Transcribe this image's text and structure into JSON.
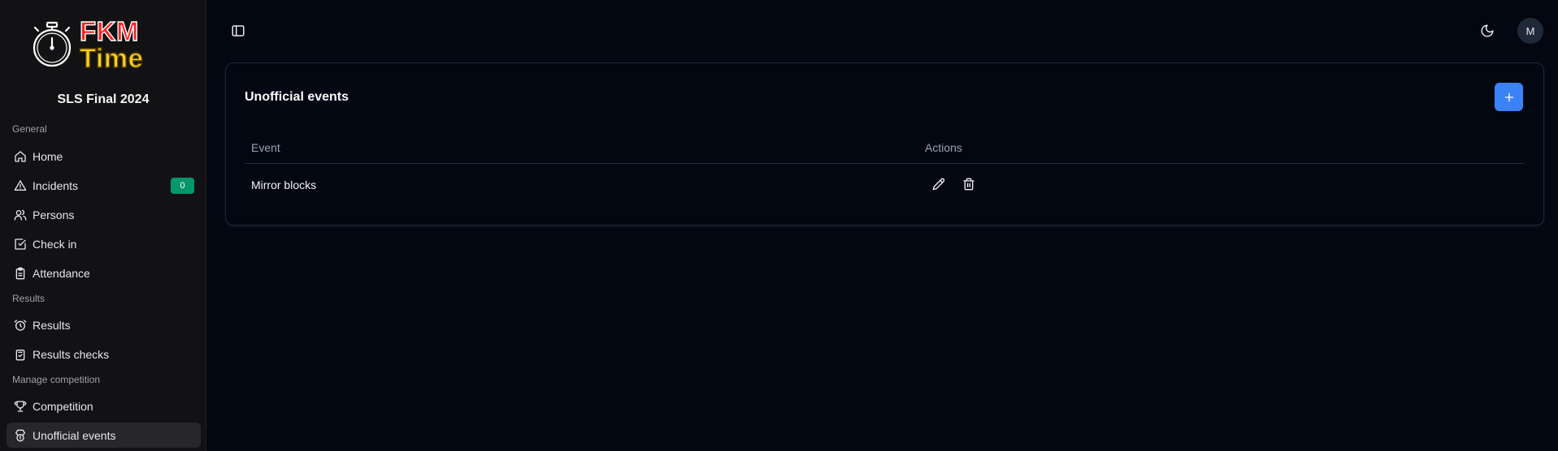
{
  "competition": {
    "name": "SLS Final 2024"
  },
  "logo": {
    "line1": "FKM",
    "line2": "Time"
  },
  "sidebar": {
    "groups": [
      {
        "label": "General"
      },
      {
        "label": "Results"
      },
      {
        "label": "Manage competition"
      }
    ],
    "items": [
      {
        "label": "Home",
        "icon": "home-icon"
      },
      {
        "label": "Incidents",
        "icon": "warning-icon",
        "badge": "0"
      },
      {
        "label": "Persons",
        "icon": "users-icon"
      },
      {
        "label": "Check in",
        "icon": "check-square-icon"
      },
      {
        "label": "Attendance",
        "icon": "clipboard-icon"
      },
      {
        "label": "Results",
        "icon": "alarm-clock-icon"
      },
      {
        "label": "Results checks",
        "icon": "clipboard-check-icon"
      },
      {
        "label": "Competition",
        "icon": "trophy-icon"
      },
      {
        "label": "Unofficial events",
        "icon": "medal-icon",
        "active": true
      }
    ]
  },
  "header": {
    "avatar_initial": "M"
  },
  "main": {
    "card_title": "Unofficial events",
    "columns": [
      "Event",
      "Actions"
    ],
    "rows": [
      {
        "event": "Mirror blocks"
      }
    ]
  },
  "colors": {
    "accent": "#3b82f6",
    "badge": "#059669",
    "background": "#030712",
    "sidebar": "#121214"
  }
}
